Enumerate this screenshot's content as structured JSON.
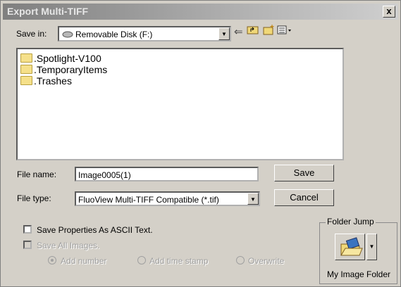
{
  "window": {
    "title": "Export Multi-TIFF",
    "close_glyph": "x"
  },
  "save_in": {
    "label": "Save in:",
    "value": "Removable Disk (F:)"
  },
  "toolbar_icons": [
    "back-arrow-icon",
    "up-folder-icon",
    "new-folder-icon",
    "view-menu-icon"
  ],
  "files": [
    ".Spotlight-V100",
    ".TemporaryItems",
    ".Trashes"
  ],
  "file_name": {
    "label": "File name:",
    "value": "Image0005(1)"
  },
  "file_type": {
    "label": "File type:",
    "value": "FluoView Multi-TIFF Compatible (*.tif)"
  },
  "buttons": {
    "save": "Save",
    "cancel": "Cancel"
  },
  "options": {
    "save_properties": {
      "label": "Save Properties As ASCII Text.",
      "checked": false
    },
    "save_all_images": {
      "label": "Save All Images.",
      "checked": false,
      "enabled": false
    },
    "radios": [
      {
        "label": "Add number",
        "selected": true
      },
      {
        "label": "Add time stamp",
        "selected": false
      },
      {
        "label": "Overwrite",
        "selected": false
      }
    ]
  },
  "folder_jump": {
    "title": "Folder Jump",
    "button_label": "My Image Folder"
  }
}
